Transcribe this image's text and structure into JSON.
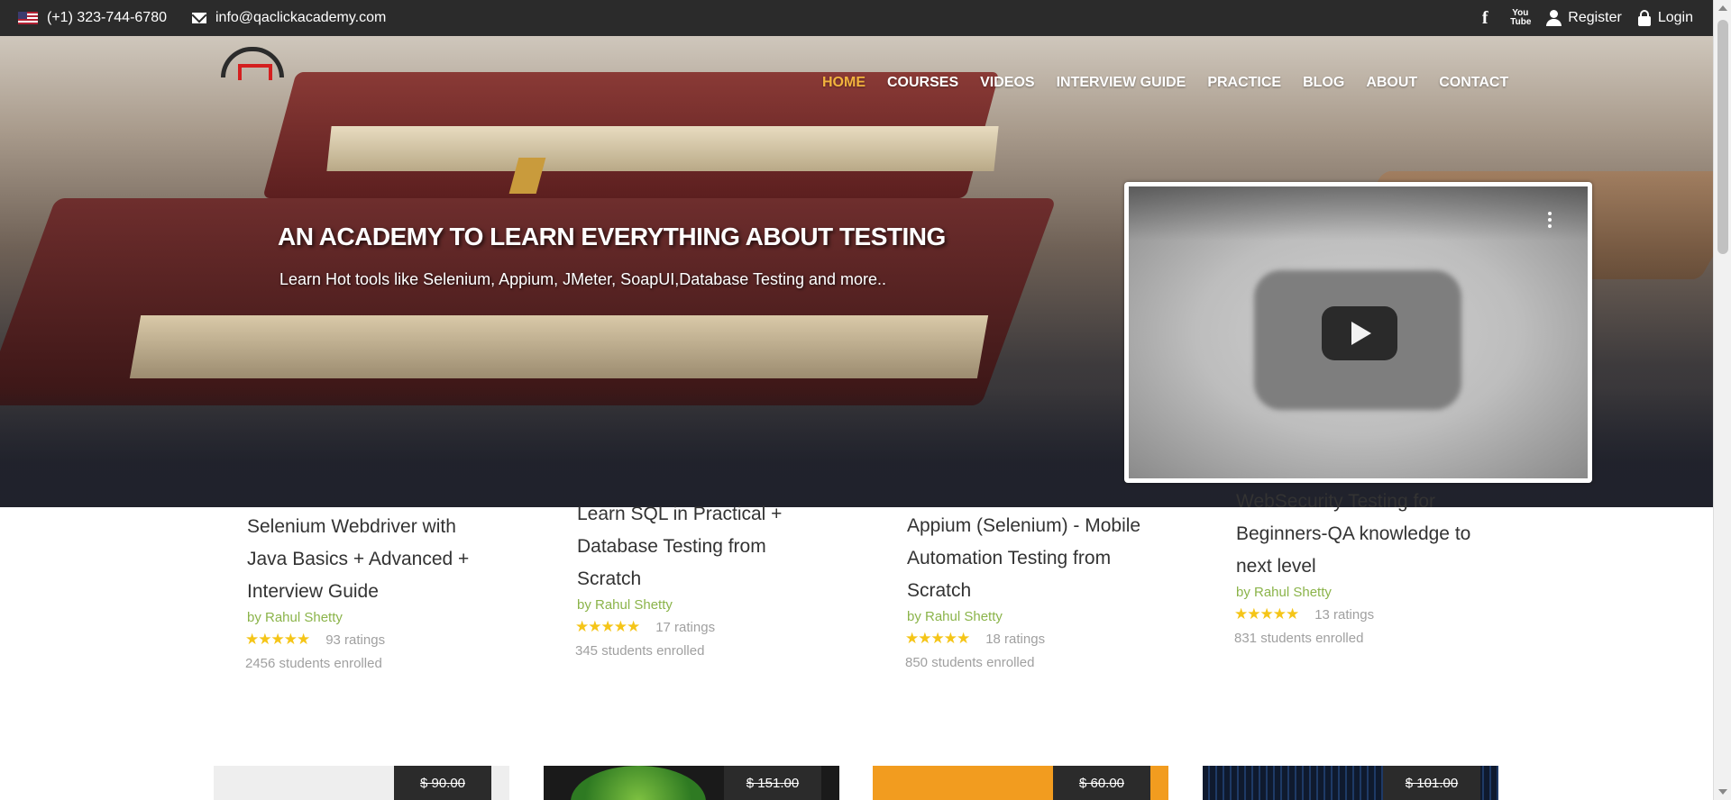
{
  "topbar": {
    "phone": "(+1) 323-744-6780",
    "email": "info@qaclickacademy.com",
    "register_label": "Register",
    "login_label": "Login",
    "youtube_label": "You Tube"
  },
  "nav": {
    "items": [
      "HOME",
      "COURSES",
      "VIDEOS",
      "INTERVIEW GUIDE",
      "PRACTICE",
      "BLOG",
      "ABOUT",
      "CONTACT"
    ],
    "active": "HOME"
  },
  "hero": {
    "title": "AN ACADEMY TO LEARN EVERYTHING ABOUT TESTING",
    "subtitle": "Learn Hot tools like Selenium, Appium, JMeter, SoapUI,Database Testing and more.."
  },
  "courses": [
    {
      "title": "Selenium Webdriver with Java Basics + Advanced + Interview Guide",
      "author": "by Rahul Shetty",
      "stars": "★★★★★",
      "ratings": "93 ratings",
      "enrolled": "2456 students enrolled"
    },
    {
      "title": "Learn SQL in Practical + Database Testing from Scratch",
      "author": "by Rahul Shetty",
      "stars": "★★★★★",
      "ratings": "17 ratings",
      "enrolled": "345 students enrolled"
    },
    {
      "title": "Appium (Selenium) - Mobile Automation Testing from Scratch",
      "author": "by Rahul Shetty",
      "stars": "★★★★★",
      "ratings": "18 ratings",
      "enrolled": "850 students enrolled"
    },
    {
      "title": "WebSecurity Testing for Beginners-QA knowledge to next level",
      "author": "by Rahul Shetty",
      "stars": "★★★★★",
      "ratings": "13 ratings",
      "enrolled": "831 students enrolled"
    }
  ],
  "cards": [
    {
      "price": "$ 90.00",
      "color": "#eeeeee"
    },
    {
      "price": "$ 151.00",
      "color": "#1a1a1a"
    },
    {
      "price": "$ 60.00",
      "color": "#f29c1f"
    },
    {
      "price": "$ 101.00",
      "color": "#0f1a2e"
    }
  ],
  "colors": {
    "accent": "#f2b33d",
    "author_green": "#8bb44a",
    "topbar": "#2b2b2b",
    "star": "#f5c518"
  }
}
